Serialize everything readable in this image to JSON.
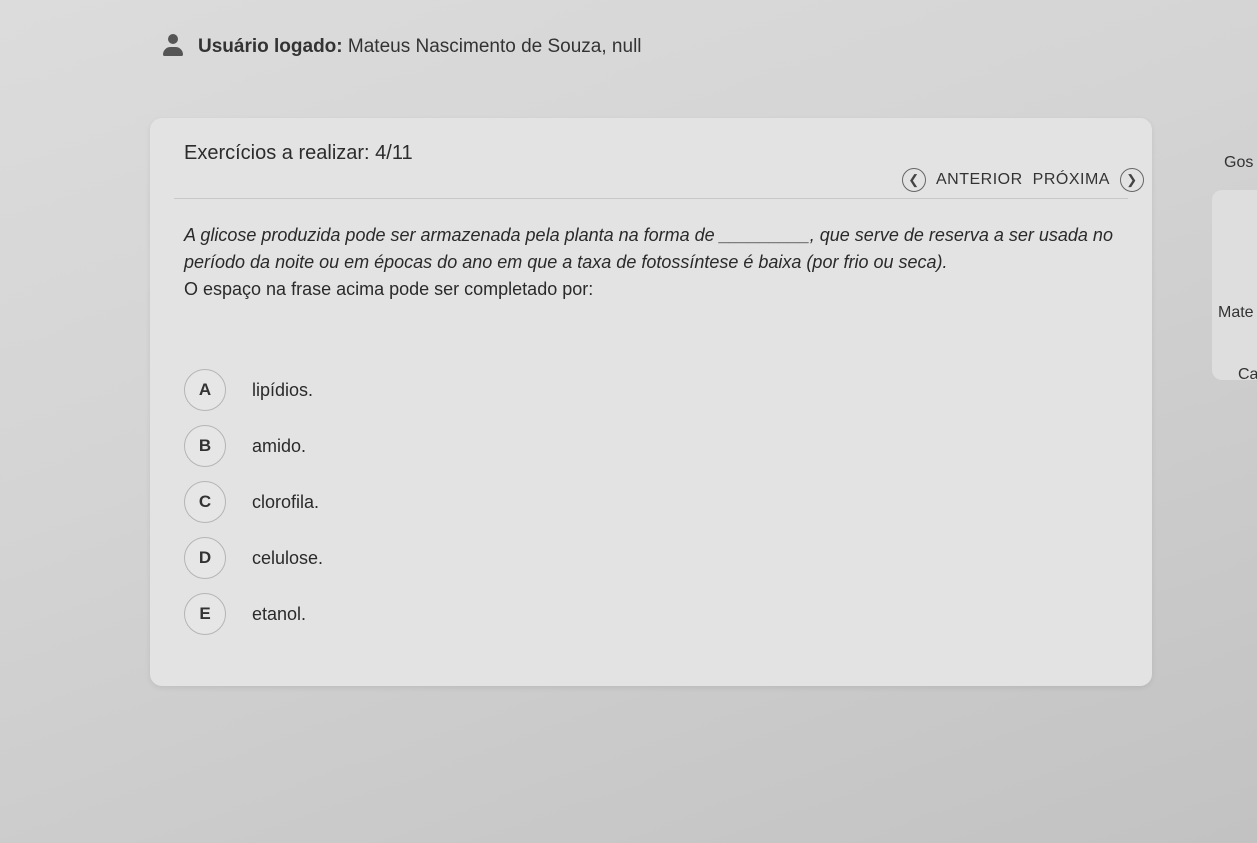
{
  "header": {
    "user_label": "Usuário logado:",
    "user_name": "Mateus Nascimento de Souza, null"
  },
  "card": {
    "title": "Exercícios a realizar: 4/11",
    "nav": {
      "prev_label": "ANTERIOR",
      "next_label": "PRÓXIMA",
      "prev_icon": "chevron-left-icon",
      "next_icon": "chevron-right-icon"
    },
    "question_part1": "A glicose produzida pode ser armazenada pela planta na forma de _________, que serve de reserva a ser usada no período da noite ou em épocas do ano em que a taxa de fotossíntese é baixa (por frio ou seca).",
    "question_part2": "O espaço na frase acima pode ser completado por:",
    "options": [
      {
        "letter": "A",
        "text": "lipídios."
      },
      {
        "letter": "B",
        "text": "amido."
      },
      {
        "letter": "C",
        "text": "clorofila."
      },
      {
        "letter": "D",
        "text": "celulose."
      },
      {
        "letter": "E",
        "text": "etanol."
      }
    ]
  },
  "side": {
    "top_label": "Gos",
    "mid_label": "Mate",
    "bottom_label": "Ca"
  }
}
